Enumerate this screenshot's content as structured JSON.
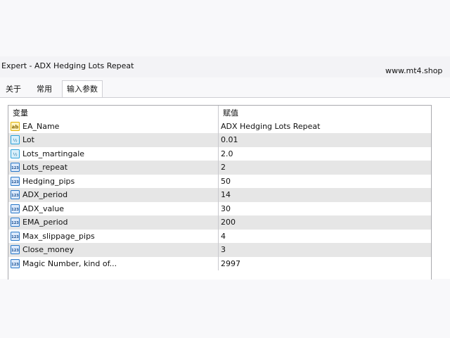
{
  "window": {
    "title": "Expert - ADX Hedging Lots Repeat",
    "watermark": "www.mt4.shop"
  },
  "tabs": [
    {
      "label": "关于",
      "active": false
    },
    {
      "label": "常用",
      "active": false
    },
    {
      "label": "输入参数",
      "active": true
    }
  ],
  "table": {
    "headers": {
      "variable": "变量",
      "value": "赋值"
    },
    "rows": [
      {
        "name": "EA_Name",
        "value": "ADX Hedging Lots Repeat",
        "icon": "string-icon"
      },
      {
        "name": "Lot",
        "value": "0.01",
        "icon": "double-icon"
      },
      {
        "name": "Lots_martingale",
        "value": "2.0",
        "icon": "double-icon"
      },
      {
        "name": "Lots_repeat",
        "value": "2",
        "icon": "integer-icon"
      },
      {
        "name": "Hedging_pips",
        "value": "50",
        "icon": "integer-icon"
      },
      {
        "name": "ADX_period",
        "value": "14",
        "icon": "integer-icon"
      },
      {
        "name": "ADX_value",
        "value": "30",
        "icon": "integer-icon"
      },
      {
        "name": "EMA_period",
        "value": "200",
        "icon": "integer-icon"
      },
      {
        "name": "Max_slippage_pips",
        "value": "4",
        "icon": "integer-icon"
      },
      {
        "name": "Close_money",
        "value": "3",
        "icon": "integer-icon"
      },
      {
        "name": "Magic Number, kind of...",
        "value": "2997",
        "icon": "integer-icon"
      }
    ]
  },
  "colors": {
    "alt_row": "#e6e6e6",
    "grid_border": "#a9a9ae",
    "string_icon": "#e0b000",
    "double_icon": "#2aa0d8",
    "integer_icon": "#2a78c8"
  }
}
